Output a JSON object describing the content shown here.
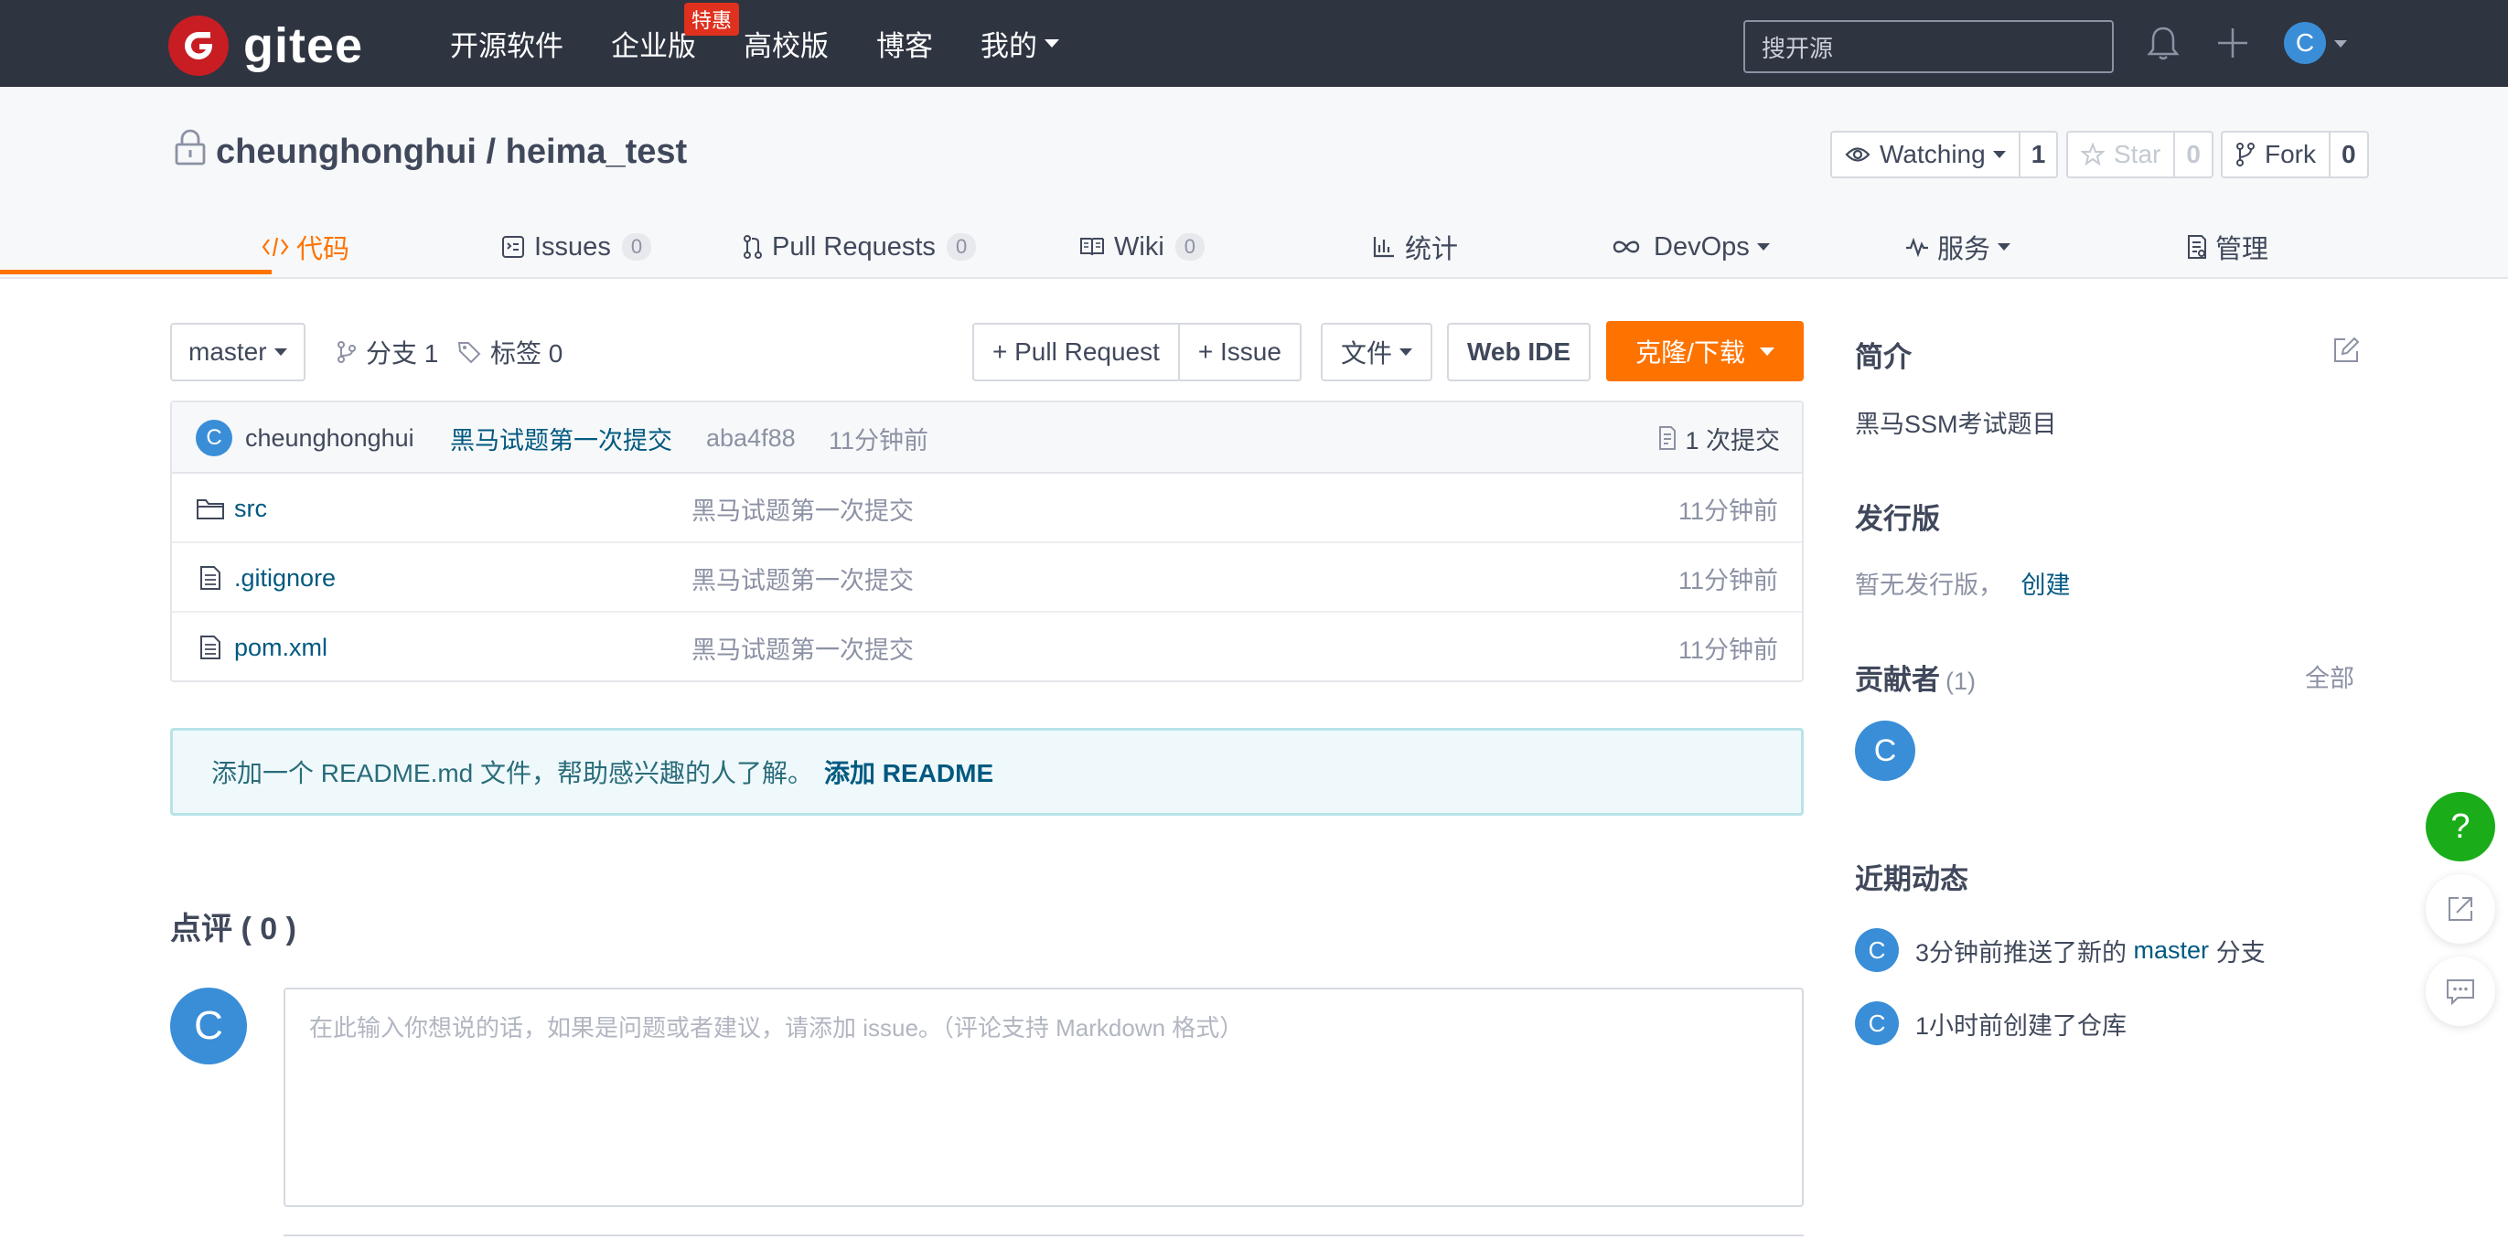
{
  "topnav": {
    "logo_text": "gitee",
    "links": [
      {
        "label": "开源软件"
      },
      {
        "label": "企业版",
        "badge": "特惠"
      },
      {
        "label": "高校版"
      },
      {
        "label": "博客"
      },
      {
        "label": "我的"
      }
    ],
    "search_placeholder": "搜开源",
    "avatar_letter": "C"
  },
  "repo": {
    "owner": "cheunghonghui",
    "separator": " / ",
    "name": "heima_test",
    "watch_label": "Watching",
    "watch_count": "1",
    "star_label": "Star",
    "star_count": "0",
    "fork_label": "Fork",
    "fork_count": "0"
  },
  "tabs": [
    {
      "label": "代码",
      "active": true
    },
    {
      "label": "Issues",
      "count": "0"
    },
    {
      "label": "Pull Requests",
      "count": "0"
    },
    {
      "label": "Wiki",
      "count": "0"
    },
    {
      "label": "统计"
    },
    {
      "label": "DevOps"
    },
    {
      "label": "服务"
    },
    {
      "label": "管理"
    }
  ],
  "toolbar": {
    "branch": "master",
    "branches_label": "分支 1",
    "tags_label": "标签 0",
    "pull_request_label": "+ Pull Request",
    "issue_label": "+ Issue",
    "files_label": "文件",
    "webide_label": "Web IDE",
    "clone_label": "克隆/下载"
  },
  "commit": {
    "avatar_letter": "C",
    "author": "cheunghonghui",
    "message": "黑马试题第一次提交",
    "hash": "aba4f88",
    "time": "11分钟前",
    "count_label": "1 次提交"
  },
  "files": [
    {
      "name": "src",
      "type": "folder",
      "message": "黑马试题第一次提交",
      "time": "11分钟前"
    },
    {
      "name": ".gitignore",
      "type": "file",
      "message": "黑马试题第一次提交",
      "time": "11分钟前"
    },
    {
      "name": "pom.xml",
      "type": "file",
      "message": "黑马试题第一次提交",
      "time": "11分钟前"
    }
  ],
  "readme_tip": {
    "text": "添加一个 README.md 文件，帮助感兴趣的人了解。",
    "link": "添加 README"
  },
  "review": {
    "title": "点评 ( 0 )",
    "avatar_letter": "C",
    "placeholder": "在此输入你想说的话，如果是问题或者建议，请添加 issue。（评论支持 Markdown 格式）"
  },
  "sidebar": {
    "intro_title": "简介",
    "intro_text": "黑马SSM考试题目",
    "release_title": "发行版",
    "release_text": "暂无发行版，",
    "release_link": "创建",
    "contributors_title": "贡献者",
    "contributors_count": "(1)",
    "contributors_all": "全部",
    "contributor_letter": "C",
    "activity_title": "近期动态",
    "activities": [
      {
        "letter": "C",
        "prefix": "3分钟前推送了新的 ",
        "branch": "master",
        "suffix": " 分支"
      },
      {
        "letter": "C",
        "text": "1小时前创建了仓库"
      }
    ]
  },
  "float": {
    "help_label": "?"
  },
  "colors": {
    "nav_bg": "#2e3440",
    "accent_orange": "#fe7300",
    "link_blue": "#005980",
    "avatar_blue": "#3a8ed8",
    "help_green": "#1aad19"
  }
}
